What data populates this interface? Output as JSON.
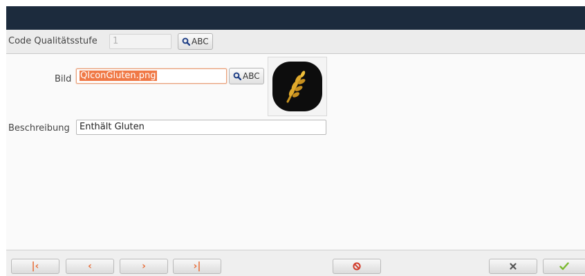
{
  "header": {
    "code_label": "Code Qualitätsstufe",
    "code_value": "1",
    "lookup_label": "ABC"
  },
  "form": {
    "bild_label": "Bild",
    "bild_value": "QIconGluten.png",
    "lookup_label": "ABC",
    "image_icon": "wheat-icon",
    "beschreibung_label": "Beschreibung",
    "beschreibung_value": "Enthält Gluten"
  },
  "toolbar": {
    "buttons": [
      {
        "icon": "first-record-icon"
      },
      {
        "icon": "previous-record-icon"
      },
      {
        "icon": "next-record-icon"
      },
      {
        "icon": "last-record-icon"
      },
      {
        "icon": "cancel-icon"
      },
      {
        "icon": "close-icon"
      },
      {
        "icon": "ok-checkmark-icon"
      }
    ]
  },
  "colors": {
    "titlebar": "#1c2b3d",
    "accent": "#f07946",
    "ok_green": "#7ab92e"
  }
}
